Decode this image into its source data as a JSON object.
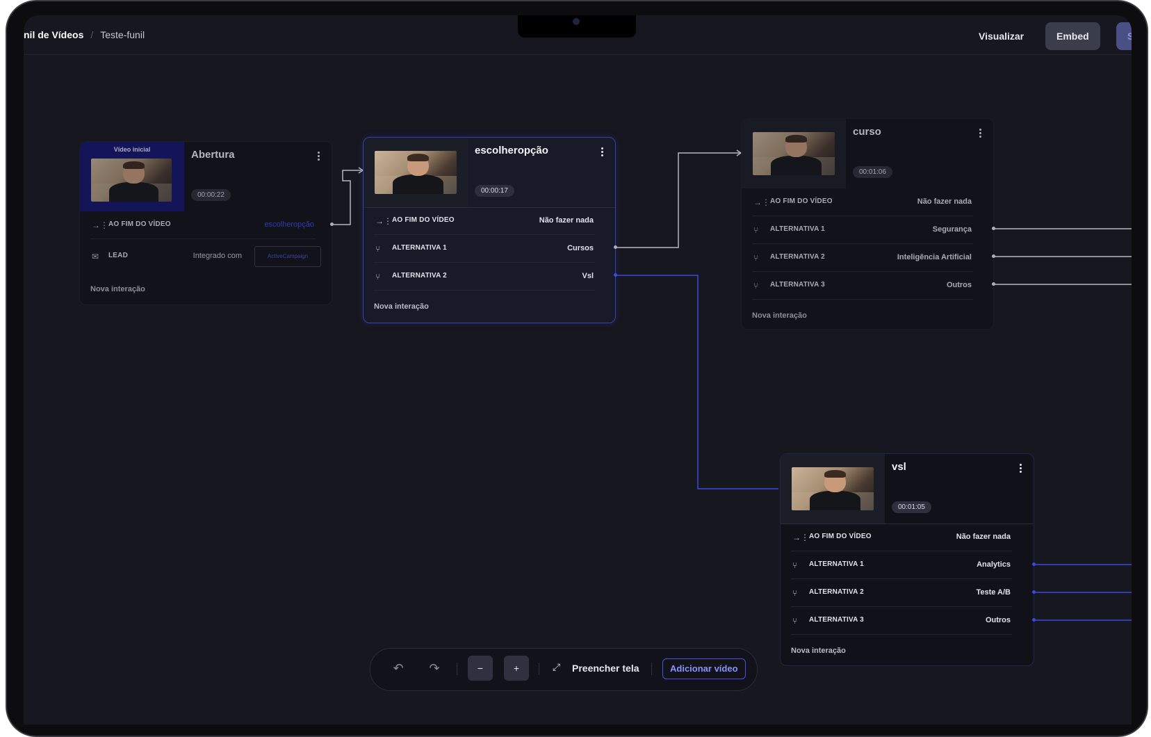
{
  "header": {
    "breadcrumb_parent": "nil de Vídeos",
    "breadcrumb_sep": "/",
    "breadcrumb_current": "Teste-funil",
    "visualizar_label": "Visualizar",
    "embed_label": "Embed",
    "save_label": "S"
  },
  "icons": {
    "end_icon": "→⋮",
    "branch_icon": "⑂",
    "mail_icon": "✉",
    "kebab_icon": "⋮",
    "undo_icon": "↶",
    "redo_icon": "↷",
    "zoom_out_icon": "−",
    "zoom_in_icon": "+",
    "expand_icon": "⤢"
  },
  "cards": {
    "abertura": {
      "badge": "Vídeo inicial",
      "title": "Abertura",
      "duration": "00:00:22",
      "rows": [
        {
          "label": "AO FIM DO VÍDEO",
          "value": "escolheropção"
        },
        {
          "label": "LEAD",
          "value": "Integrado com",
          "box": "ActiveCampaign"
        }
      ],
      "nova": "Nova interação"
    },
    "escolher": {
      "title": "escolheropção",
      "duration": "00:00:17",
      "rows": [
        {
          "label": "AO FIM DO VÍDEO",
          "value": "Não fazer nada"
        },
        {
          "label": "ALTERNATIVA 1",
          "value": "Cursos"
        },
        {
          "label": "ALTERNATIVA 2",
          "value": "Vsl"
        }
      ],
      "nova": "Nova interação"
    },
    "curso": {
      "title": "curso",
      "duration": "00:01:06",
      "rows": [
        {
          "label": "AO FIM DO VÍDEO",
          "value": "Não fazer nada"
        },
        {
          "label": "ALTERNATIVA 1",
          "value": "Segurança"
        },
        {
          "label": "ALTERNATIVA 2",
          "value": "Inteligência Artificial"
        },
        {
          "label": "ALTERNATIVA 3",
          "value": "Outros"
        }
      ],
      "nova": "Nova interação"
    },
    "vsl": {
      "title": "vsl",
      "duration": "00:01:05",
      "rows": [
        {
          "label": "AO FIM DO VÍDEO",
          "value": "Não fazer nada"
        },
        {
          "label": "ALTERNATIVA 1",
          "value": "Analytics"
        },
        {
          "label": "ALTERNATIVA 2",
          "value": "Teste A/B"
        },
        {
          "label": "ALTERNATIVA 3",
          "value": "Outros"
        }
      ],
      "nova": "Nova interação"
    }
  },
  "toolbar": {
    "fill_label": "Preencher tela",
    "add_label": "Adicionar vídeo"
  },
  "colors": {
    "accent": "#3d48e8",
    "background": "#16171f"
  }
}
